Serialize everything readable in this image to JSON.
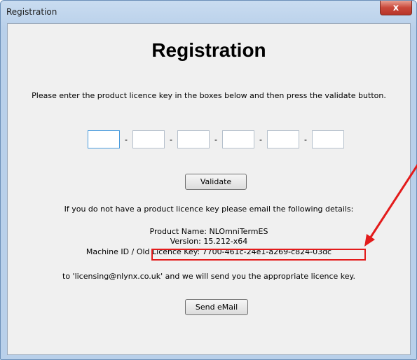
{
  "window": {
    "title": "Registration",
    "close_glyph": "x"
  },
  "main": {
    "heading": "Registration",
    "instruction": "Please enter the product licence key in the boxes below and then press the validate button.",
    "key_separator": "-",
    "validate_label": "Validate",
    "no_key_text": "If you do not have a product licence key please email the following details:",
    "product_name": "Product Name: NLOmniTermES",
    "version": "Version: 15.212-x64",
    "machine_id": "Machine ID / Old Licence Key: 7700-461c-24e1-a269-c824-03dc",
    "email_text": "to 'licensing@nlynx.co.uk' and we will send you the appropriate licence key.",
    "send_label": "Send eMail"
  },
  "colors": {
    "annotation": "#e31b1b"
  }
}
